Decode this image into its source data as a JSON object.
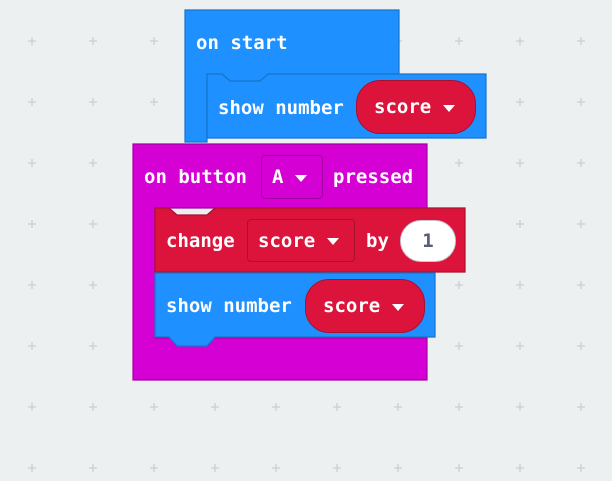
{
  "on_start": {
    "label": "on start",
    "show_number": {
      "label": "show number",
      "variable": "score"
    }
  },
  "on_button": {
    "label_prefix": "on button",
    "button": "A",
    "label_suffix": "pressed",
    "change": {
      "label": "change",
      "variable": "score",
      "by_label": "by",
      "value": "1"
    },
    "show_number": {
      "label": "show number",
      "variable": "score"
    }
  },
  "colors": {
    "workspace": "#ecf0f1",
    "basic_block": "#1e90ff",
    "input_block": "#d400d4",
    "variable_block": "#dc143c",
    "number_text": "#575e75"
  },
  "icons": {
    "dropdown": "caret-down-icon"
  }
}
